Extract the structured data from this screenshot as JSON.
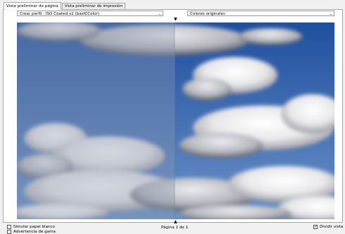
{
  "tabs": [
    {
      "label": "Vista preliminar de página",
      "active": true
    },
    {
      "label": "Vista preliminar de impresión",
      "active": false
    }
  ],
  "profile_select": {
    "value": "Crear perfil : ISO Coated v2 (basICColor)"
  },
  "colors_select": {
    "value": "Colores originales"
  },
  "footer": {
    "simulate_paper": {
      "label": "Simular papel blanco",
      "checked": false
    },
    "gamut_warning": {
      "label": "Advertencia de gama",
      "checked": false
    },
    "page_info": "Página 1 de 1",
    "split_view": {
      "label": "Dividir vista",
      "checked": true
    }
  },
  "icons": {
    "split_marker_top": "triangle-down-icon",
    "split_marker_bottom": "triangle-up-icon",
    "dropdown": "chevron-down-icon"
  },
  "colors": {
    "sky_top": "#1f4f9f",
    "sky_bottom": "#5f87c0",
    "soft_proof_overlay": "#8a96ad"
  }
}
